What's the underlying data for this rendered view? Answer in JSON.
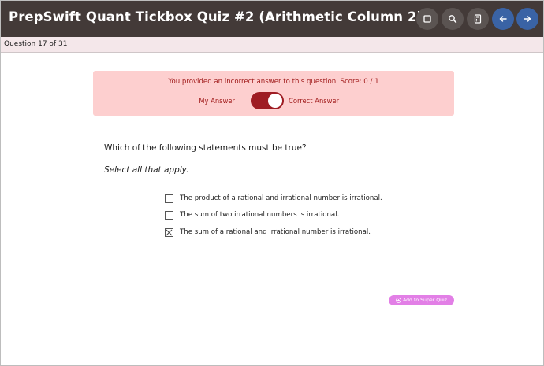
{
  "header": {
    "title": "PrepSwift Quant Tickbox Quiz #2 (Arithmetic Column 2)",
    "buttons": [
      {
        "icon": "square-icon"
      },
      {
        "icon": "search-icon"
      },
      {
        "icon": "calculator-icon"
      },
      {
        "icon": "arrow-left-icon"
      },
      {
        "icon": "arrow-right-icon"
      }
    ]
  },
  "question_bar": {
    "label": "Question 17 of 31"
  },
  "feedback": {
    "message": "You provided an incorrect answer to this question. Score: 0 / 1",
    "toggle_left_label": "My Answer",
    "toggle_right_label": "Correct Answer",
    "toggle_state": "correct-answer"
  },
  "question": {
    "text": "Which of the following statements must be true?",
    "instruction": "Select all that apply.",
    "options": [
      {
        "label": "The product of a rational and irrational number is irrational.",
        "checked": false
      },
      {
        "label": "The sum of two irrational numbers is irrational.",
        "checked": false
      },
      {
        "label": "The sum of a rational and irrational number is irrational.",
        "checked": true
      }
    ]
  },
  "super_quiz_button": {
    "label": "Add to Super Quiz"
  },
  "colors": {
    "topbar": "#433a38",
    "alert_bg": "#fdcfcf",
    "alert_text": "#a11c1c",
    "toggle": "#9e1c23",
    "nav_blue": "#3a63a5",
    "super_quiz": "#e27fe6"
  }
}
